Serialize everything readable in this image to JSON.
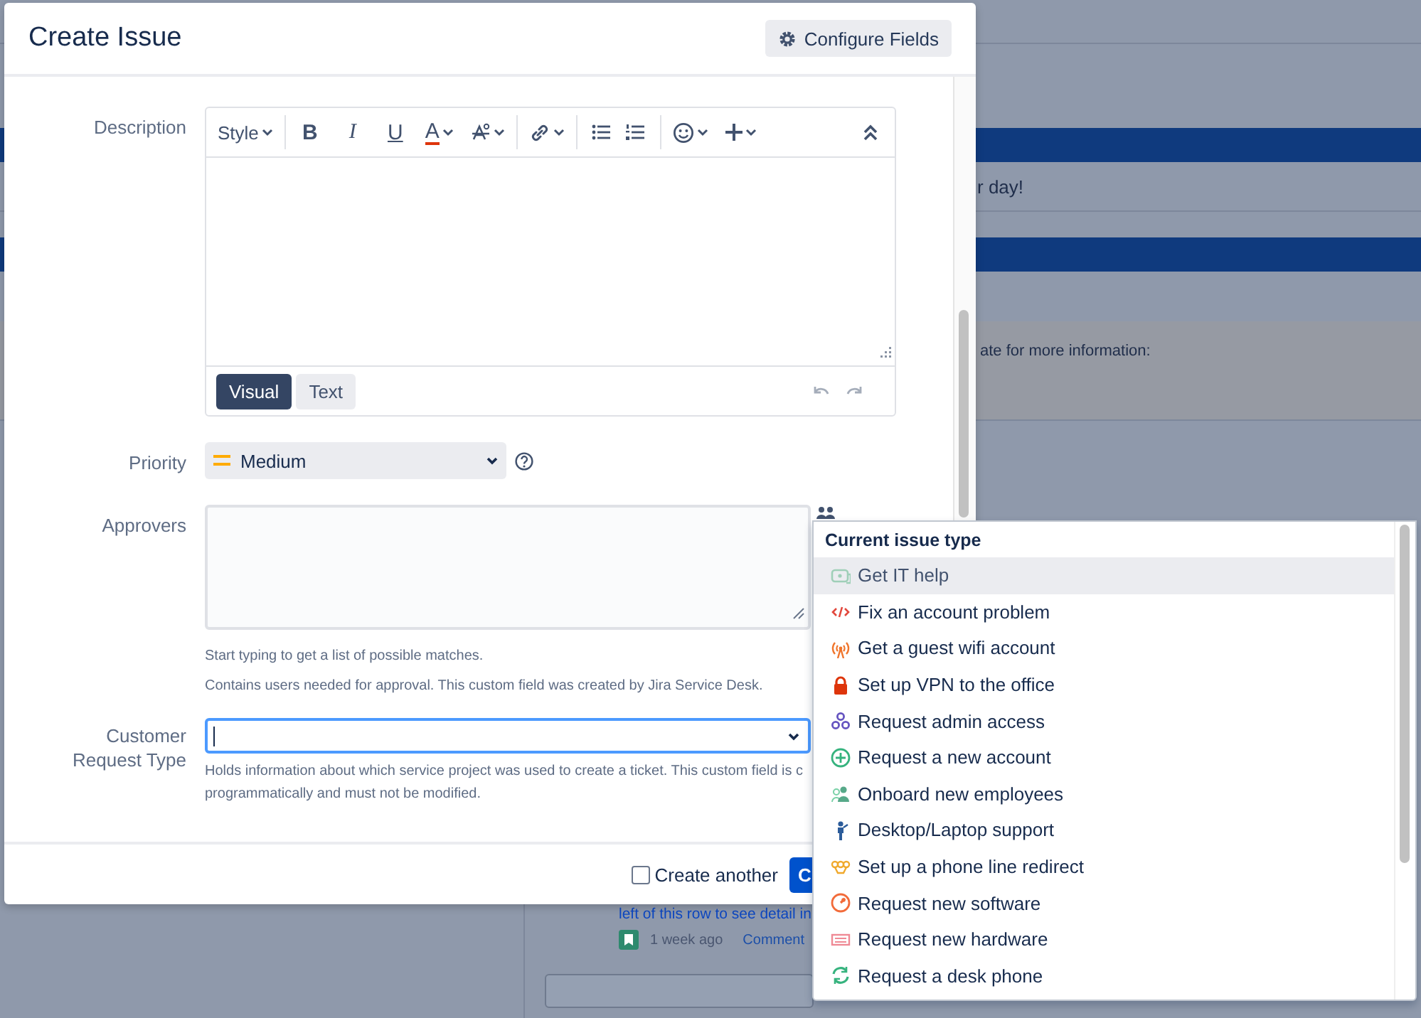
{
  "background": {
    "greeting": "r day!",
    "info": "ate for more information:",
    "link": "left of this row to see detail in",
    "age": "1 week ago",
    "comment": "Comment"
  },
  "modal": {
    "title": "Create Issue",
    "configure_button": "Configure Fields"
  },
  "description": {
    "label": "Description",
    "style_menu": "Style",
    "format_buttons": [
      "B",
      "I",
      "U",
      "A"
    ],
    "modes": [
      {
        "label": "Visual",
        "selected": true
      },
      {
        "label": "Text",
        "selected": false
      }
    ]
  },
  "priority": {
    "label": "Priority",
    "value": "Medium"
  },
  "approvers": {
    "label": "Approvers",
    "hints": [
      "Start typing to get a list of possible matches.",
      "Contains users needed for approval. This custom field was created by Jira Service Desk."
    ]
  },
  "customer_request_type": {
    "label": "Customer Request Type",
    "hints": [
      "Holds information about which service project was used to create a ticket. This custom field is c",
      "programmatically and must not be modified."
    ]
  },
  "footer": {
    "create_another": {
      "label": "Create another",
      "checked": false
    },
    "create_button": "C"
  },
  "dropdown": {
    "heading": "Current issue type",
    "items": [
      {
        "label": "Get IT help",
        "selected": true
      },
      {
        "label": "Fix an account problem",
        "selected": false
      },
      {
        "label": "Get a guest wifi account",
        "selected": false
      },
      {
        "label": "Set up VPN to the office",
        "selected": false
      },
      {
        "label": "Request admin access",
        "selected": false
      },
      {
        "label": "Request a new account",
        "selected": false
      },
      {
        "label": "Onboard new employees",
        "selected": false
      },
      {
        "label": "Desktop/Laptop support",
        "selected": false
      },
      {
        "label": "Set up a phone line redirect",
        "selected": false
      },
      {
        "label": "Request new software",
        "selected": false
      },
      {
        "label": "Request new hardware",
        "selected": false
      },
      {
        "label": "Request a desk phone",
        "selected": false
      }
    ]
  }
}
